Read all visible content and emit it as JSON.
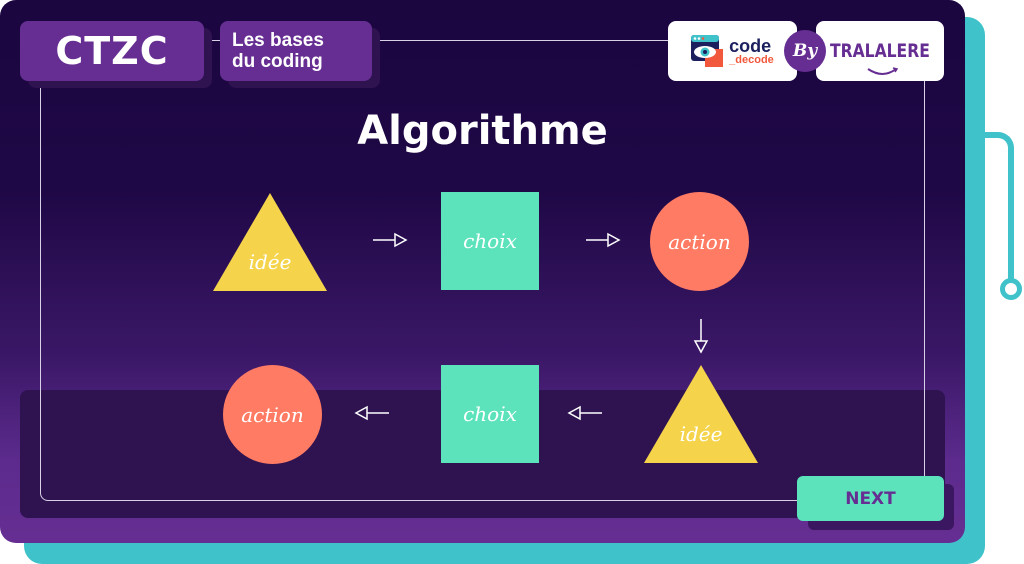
{
  "header": {
    "logo": "CTZC",
    "subtitle_line1": "Les bases",
    "subtitle_line2": "du coding",
    "partner1_word1": "code",
    "partner1_word2": "_decode",
    "by_label": "By",
    "partner2": "TRALALERE"
  },
  "main": {
    "title": "Algorithme",
    "flow_top": [
      {
        "shape": "triangle",
        "label": "idée"
      },
      {
        "shape": "square",
        "label": "choix"
      },
      {
        "shape": "circle",
        "label": "action"
      }
    ],
    "flow_bottom": [
      {
        "shape": "circle",
        "label": "action"
      },
      {
        "shape": "square",
        "label": "choix"
      },
      {
        "shape": "triangle",
        "label": "idée"
      }
    ]
  },
  "footer": {
    "next_label": "NEXT"
  },
  "colors": {
    "purple": "#662e92",
    "dark": "#1b0640",
    "teal": "#3fc2c9",
    "mint": "#5de3bb",
    "coral": "#ff7b63",
    "yellow": "#f5d44b"
  }
}
